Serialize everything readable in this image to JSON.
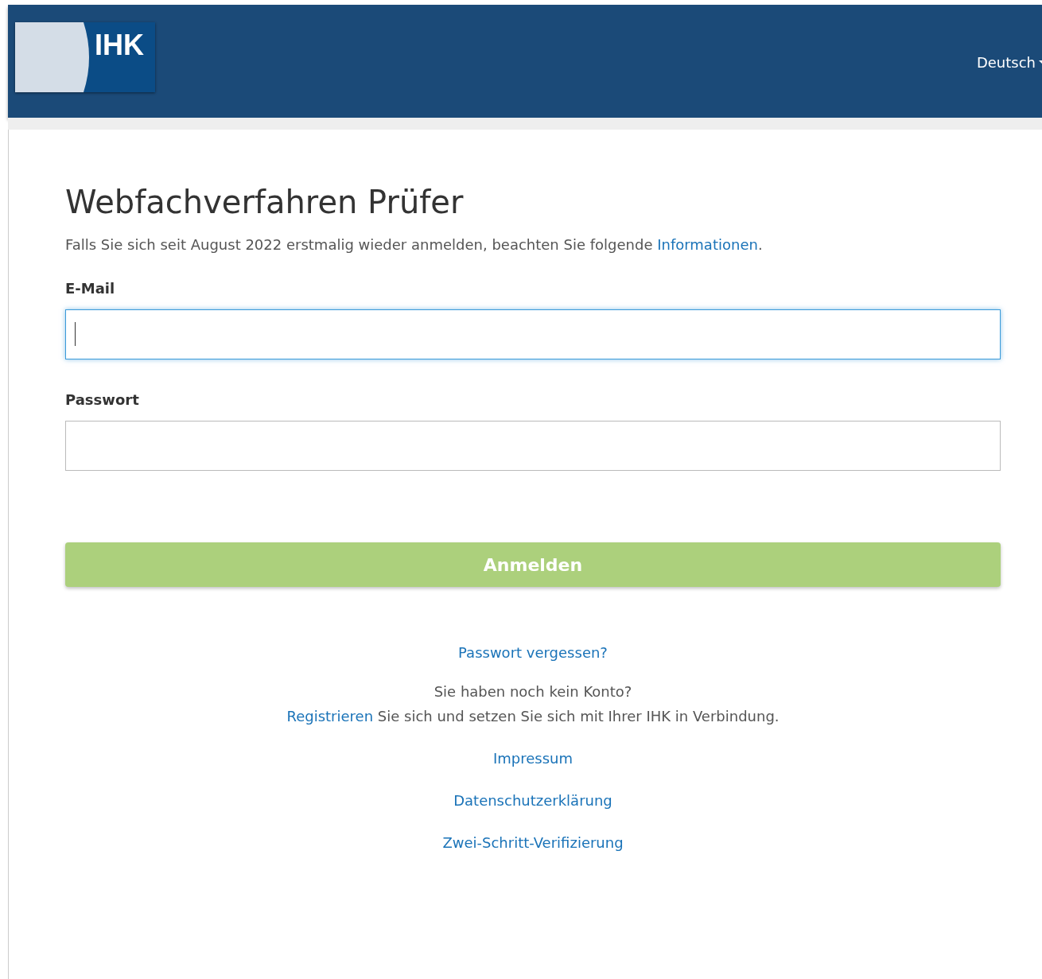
{
  "header": {
    "logo": {
      "text": "IHK"
    },
    "language": {
      "label": "Deutsch"
    }
  },
  "title": "Webfachverfahren Prüfer",
  "notice": {
    "text": "Falls Sie sich seit August 2022 erstmalig wieder anmelden, beachten Sie folgende ",
    "link": "Informationen",
    "end": "."
  },
  "fields": [
    {
      "label": "E-Mail",
      "focused": true
    },
    {
      "label": "Passwort",
      "focused": false
    }
  ],
  "submit": {
    "label": "Anmelden",
    "disabled": true
  },
  "forgot_link": "Passwort vergessen?",
  "no_account": "Sie haben noch kein Konto?",
  "register": {
    "link": "Registrieren",
    "text": " Sie sich und setzen Sie sich mit Ihrer IHK in Verbindung."
  },
  "footer_links": [
    "Impressum",
    "Datenschutzerklärung",
    "Zwei-Schritt-Verifizierung"
  ]
}
